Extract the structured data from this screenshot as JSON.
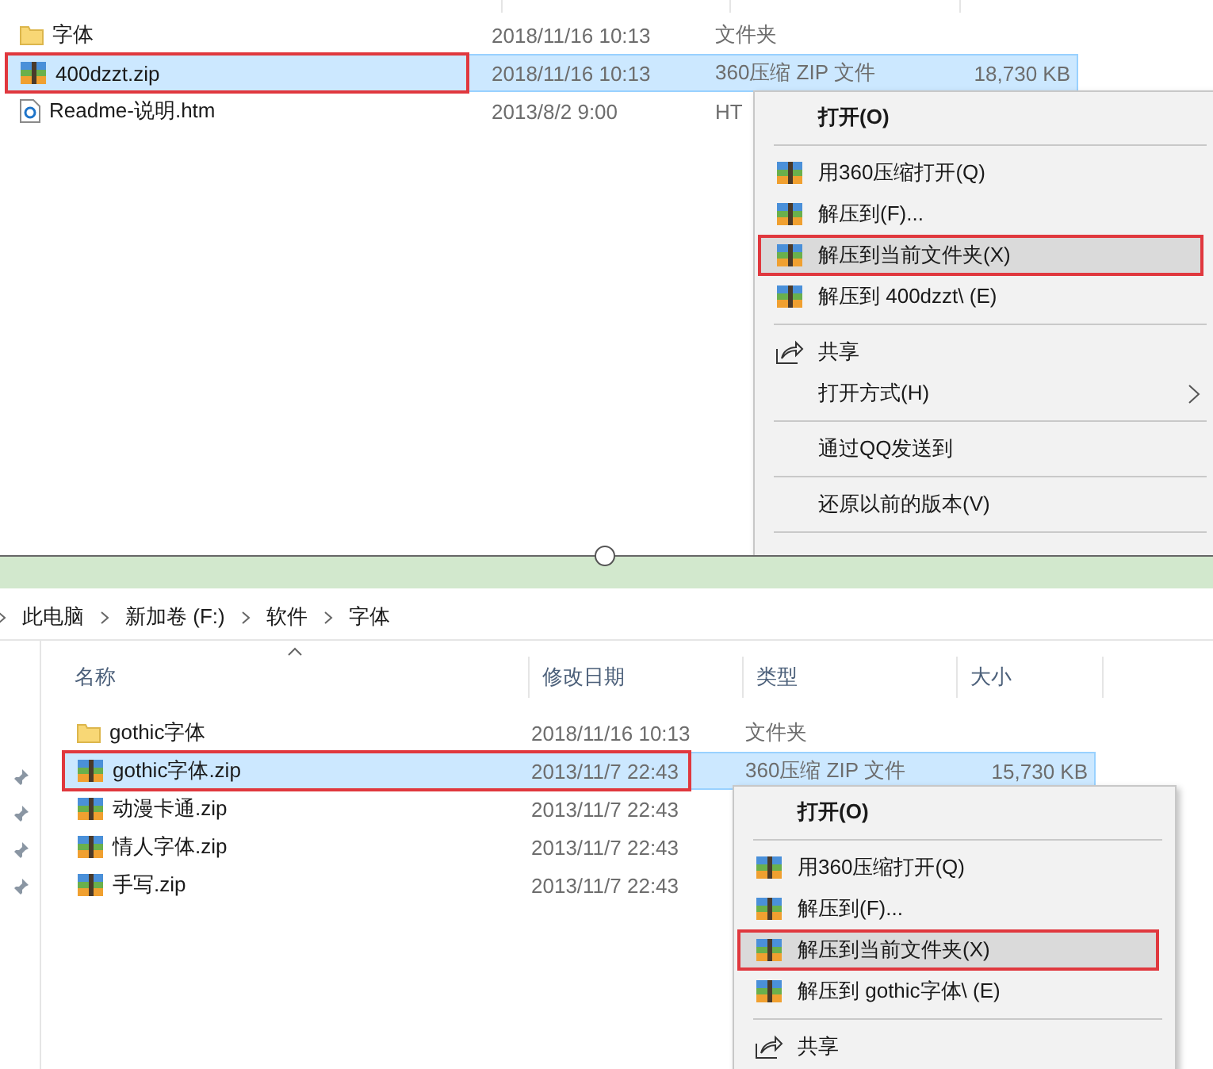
{
  "top_pane": {
    "rows": [
      {
        "kind": "folder",
        "name": "字体",
        "date": "2018/11/16 10:13",
        "file_type": "文件夹",
        "selected": false,
        "marked": false
      },
      {
        "kind": "zip",
        "name": "400dzzt.zip",
        "date": "2018/11/16 10:13",
        "file_type": "360压缩 ZIP 文件",
        "size": "18,730 KB",
        "selected": true,
        "marked": true
      },
      {
        "kind": "html",
        "name": "Readme-说明.htm",
        "date": "2013/8/2 9:00",
        "file_type": "HT",
        "selected": false,
        "marked": false
      }
    ],
    "context_menu": {
      "items": [
        {
          "kind": "plain",
          "label": "打开(O)",
          "bold": true,
          "hovered": false,
          "marked": false
        },
        {
          "kind": "separator"
        },
        {
          "kind": "archive",
          "label": "用360压缩打开(Q)",
          "hovered": false,
          "marked": false
        },
        {
          "kind": "archive",
          "label": "解压到(F)...",
          "hovered": false,
          "marked": false
        },
        {
          "kind": "archive",
          "label": "解压到当前文件夹(X)",
          "hovered": true,
          "marked": true
        },
        {
          "kind": "archive",
          "label": "解压到 400dzzt\\ (E)",
          "hovered": false,
          "marked": false
        },
        {
          "kind": "separator"
        },
        {
          "kind": "share",
          "label": "共享",
          "hovered": false,
          "marked": false
        },
        {
          "kind": "plain",
          "label": "打开方式(H)",
          "submenu": true,
          "hovered": false,
          "marked": false
        },
        {
          "kind": "separator"
        },
        {
          "kind": "plain",
          "label": "通过QQ发送到",
          "hovered": false,
          "marked": false
        },
        {
          "kind": "separator"
        },
        {
          "kind": "plain",
          "label": "还原以前的版本(V)",
          "hovered": false,
          "marked": false
        },
        {
          "kind": "separator"
        }
      ]
    }
  },
  "bottom_pane": {
    "breadcrumb": [
      "此电脑",
      "新加卷 (F:)",
      "软件",
      "字体"
    ],
    "columns": [
      "名称",
      "修改日期",
      "类型",
      "大小"
    ],
    "rows": [
      {
        "kind": "folder",
        "name": "gothic字体",
        "date": "2018/11/16 10:13",
        "file_type": "文件夹",
        "selected": false,
        "marked": false
      },
      {
        "kind": "zip",
        "name": "gothic字体.zip",
        "date": "2013/11/7 22:43",
        "file_type": "360压缩 ZIP 文件",
        "size": "15,730 KB",
        "selected": true,
        "marked": true
      },
      {
        "kind": "zip",
        "name": "动漫卡通.zip",
        "date": "2013/11/7 22:43",
        "selected": false,
        "marked": false
      },
      {
        "kind": "zip",
        "name": "情人字体.zip",
        "date": "2013/11/7 22:43",
        "selected": false,
        "marked": false
      },
      {
        "kind": "zip",
        "name": "手写.zip",
        "date": "2013/11/7 22:43",
        "selected": false,
        "marked": false
      }
    ],
    "context_menu": {
      "items": [
        {
          "kind": "plain",
          "label": "打开(O)",
          "bold": true,
          "hovered": false,
          "marked": false
        },
        {
          "kind": "separator"
        },
        {
          "kind": "archive",
          "label": "用360压缩打开(Q)",
          "hovered": false,
          "marked": false
        },
        {
          "kind": "archive",
          "label": "解压到(F)...",
          "hovered": false,
          "marked": false
        },
        {
          "kind": "archive",
          "label": "解压到当前文件夹(X)",
          "hovered": true,
          "marked": true
        },
        {
          "kind": "archive",
          "label": "解压到 gothic字体\\ (E)",
          "hovered": false,
          "marked": false
        },
        {
          "kind": "separator"
        },
        {
          "kind": "share",
          "label": "共享",
          "hovered": false,
          "marked": false
        }
      ]
    }
  }
}
